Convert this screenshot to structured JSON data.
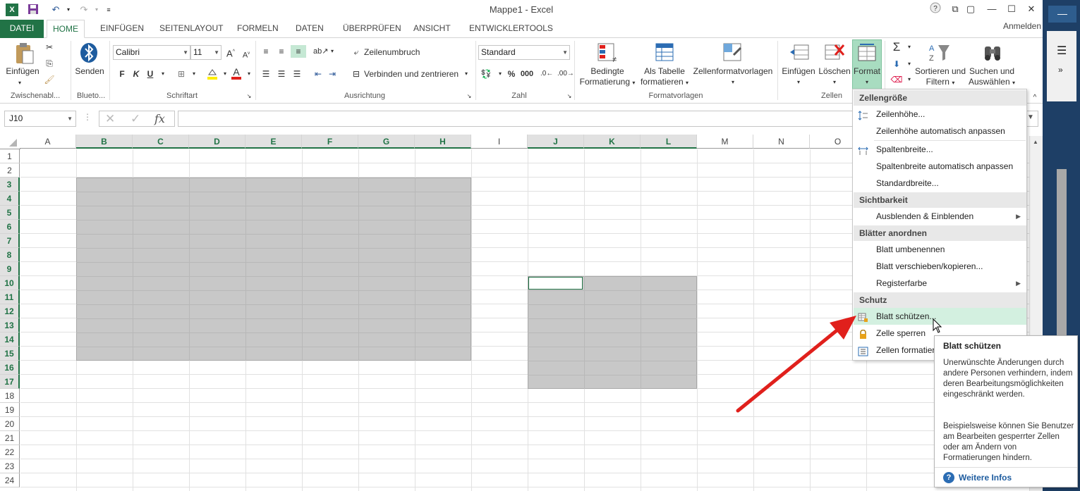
{
  "window": {
    "title": "Mappe1 - Excel",
    "signin": "Anmelden",
    "help": "?",
    "minimize": "—",
    "maximize": "☐",
    "close": "✕"
  },
  "tabs": [
    "DATEI",
    "START",
    "EINFÜGEN",
    "SEITENLAYOUT",
    "FORMELN",
    "DATEN",
    "ÜBERPRÜFEN",
    "ANSICHT",
    "ENTWICKLERTOOLS"
  ],
  "tabs_visible": [
    "DATEI",
    "HOME",
    "EINFÜGEN",
    "SEITENLAYOUT",
    "FORMELN",
    "DATEN",
    "ÜBERPRÜFEN",
    "ANSICHT",
    "ENTWICKLERTOOLS"
  ],
  "ribbon": {
    "clipboard": {
      "paste": "Einfügen",
      "label": "Zwischenabl..."
    },
    "bluetooth": {
      "send": "Senden",
      "label": "Blueto..."
    },
    "font": {
      "name": "Calibri",
      "size": "11",
      "bold": "F",
      "italic": "K",
      "underline": "U",
      "label": "Schriftart"
    },
    "alignment": {
      "wrap": "Zeilenumbruch",
      "merge": "Verbinden und zentrieren",
      "label": "Ausrichtung"
    },
    "number": {
      "format": "Standard",
      "label": "Zahl",
      "percent": "%",
      "thousands": "000"
    },
    "styles": {
      "conditional_1": "Bedingte",
      "conditional_2": "Formatierung",
      "astable_1": "Als Tabelle",
      "astable_2": "formatieren",
      "cellstyles": "Zellenformatvorlagen",
      "label": "Formatvorlagen"
    },
    "cells": {
      "insert": "Einfügen",
      "delete": "Löschen",
      "format": "Format",
      "label": "Zellen"
    },
    "editing": {
      "sort_1": "Sortieren und",
      "sort_2": "Filtern",
      "find_1": "Suchen und",
      "find_2": "Auswählen"
    }
  },
  "formula_bar": {
    "namebox": "J10",
    "value": "",
    "fx": "fx"
  },
  "columns": [
    "A",
    "B",
    "C",
    "D",
    "E",
    "F",
    "G",
    "H",
    "I",
    "J",
    "K",
    "L",
    "M",
    "N",
    "O"
  ],
  "rows": [
    "1",
    "2",
    "3",
    "4",
    "5",
    "6",
    "7",
    "8",
    "9",
    "10",
    "11",
    "12",
    "13",
    "14",
    "15",
    "16",
    "17",
    "18",
    "19",
    "20",
    "21",
    "22",
    "23",
    "24"
  ],
  "menu": {
    "sections": [
      {
        "header": "Zellengröße",
        "items": [
          "Zeilenhöhe...",
          "Zeilenhöhe automatisch anpassen",
          "Spaltenbreite...",
          "Spaltenbreite automatisch anpassen",
          "Standardbreite..."
        ]
      },
      {
        "header": "Sichtbarkeit",
        "items": [
          "Ausblenden & Einblenden"
        ]
      },
      {
        "header": "Blätter anordnen",
        "items": [
          "Blatt umbenennen",
          "Blatt verschieben/kopieren...",
          "Registerfarbe"
        ]
      },
      {
        "header": "Schutz",
        "items": [
          "Blatt schützen...",
          "Zelle sperren",
          "Zellen formatieren..."
        ]
      }
    ]
  },
  "tooltip": {
    "title": "Blatt schützen",
    "p1": "Unerwünschte Änderungen durch andere Personen verhindern, indem deren Bearbeitungsmöglichkeiten eingeschränkt werden.",
    "p2": "Beispielsweise können Sie Benutzer am Bearbeiten gesperrter Zellen oder am Ändern von Formatierungen hindern.",
    "more": "Weitere Infos"
  },
  "colors": {
    "accent": "#217346",
    "highlight": "#d3f0e0",
    "arrow": "#e0201c",
    "shade": "#c8c8c8"
  }
}
